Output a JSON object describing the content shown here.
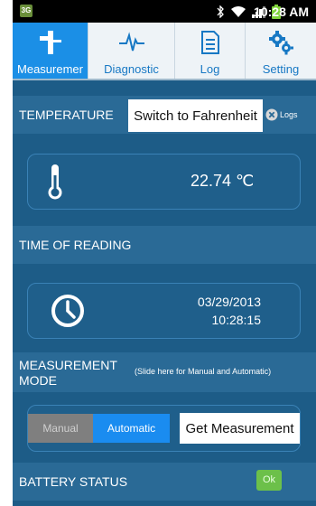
{
  "status_bar": {
    "network": "3G",
    "time": "10:28 AM"
  },
  "tabs": [
    {
      "label": "Measuremer",
      "icon": "measurement-icon",
      "active": true
    },
    {
      "label": "Diagnostic",
      "icon": "pulse-icon",
      "active": false
    },
    {
      "label": "Log",
      "icon": "document-icon",
      "active": false
    },
    {
      "label": "Setting",
      "icon": "gears-icon",
      "active": false
    }
  ],
  "temperature": {
    "title": "TEMPERATURE",
    "switch_button": "Switch to Fahrenheit",
    "logs_label": "Logs",
    "value": "22.74 ℃"
  },
  "time_of_reading": {
    "title": "TIME OF READING",
    "date": "03/29/2013",
    "time": "10:28:15"
  },
  "measurement_mode": {
    "title_line1": "MEASUREMENT",
    "title_line2": "MODE",
    "hint": "(Slide here for Manual and Automatic)",
    "manual_label": "Manual",
    "automatic_label": "Automatic",
    "selected": "Automatic",
    "get_button": "Get Measurement"
  },
  "battery": {
    "title": "BATTERY STATUS",
    "status": "Ok"
  },
  "colors": {
    "background": "#1d5c87",
    "tab_active": "#1b8fe6",
    "toggle_active": "#1a8cf0",
    "battery_ok": "#6cc04a"
  }
}
